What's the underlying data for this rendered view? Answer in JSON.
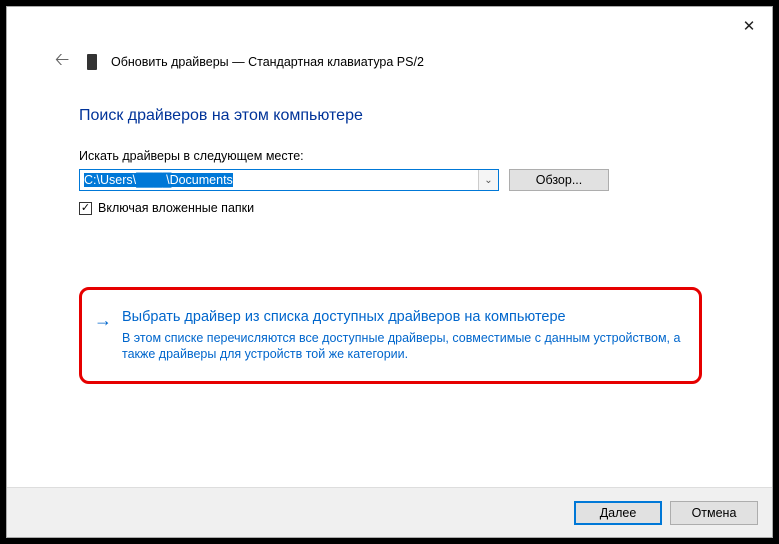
{
  "titlebar": {
    "close_tooltip": "Закрыть"
  },
  "header": {
    "title": "Обновить драйверы — Стандартная клавиатура PS/2"
  },
  "page": {
    "title": "Поиск драйверов на этом компьютере",
    "search_label": "Искать драйверы в следующем месте:",
    "path_prefix": "C:\\Users\\",
    "path_hidden": "████",
    "path_suffix": "\\Documents",
    "browse_button": "Обзор...",
    "include_subfolders": "Включая вложенные папки",
    "include_subfolders_checked": true,
    "option": {
      "title": "Выбрать драйвер из списка доступных драйверов на компьютере",
      "description": "В этом списке перечисляются все доступные драйверы, совместимые с данным устройством, а также драйверы для устройств той же категории."
    }
  },
  "footer": {
    "next": "Далее",
    "cancel": "Отмена"
  }
}
